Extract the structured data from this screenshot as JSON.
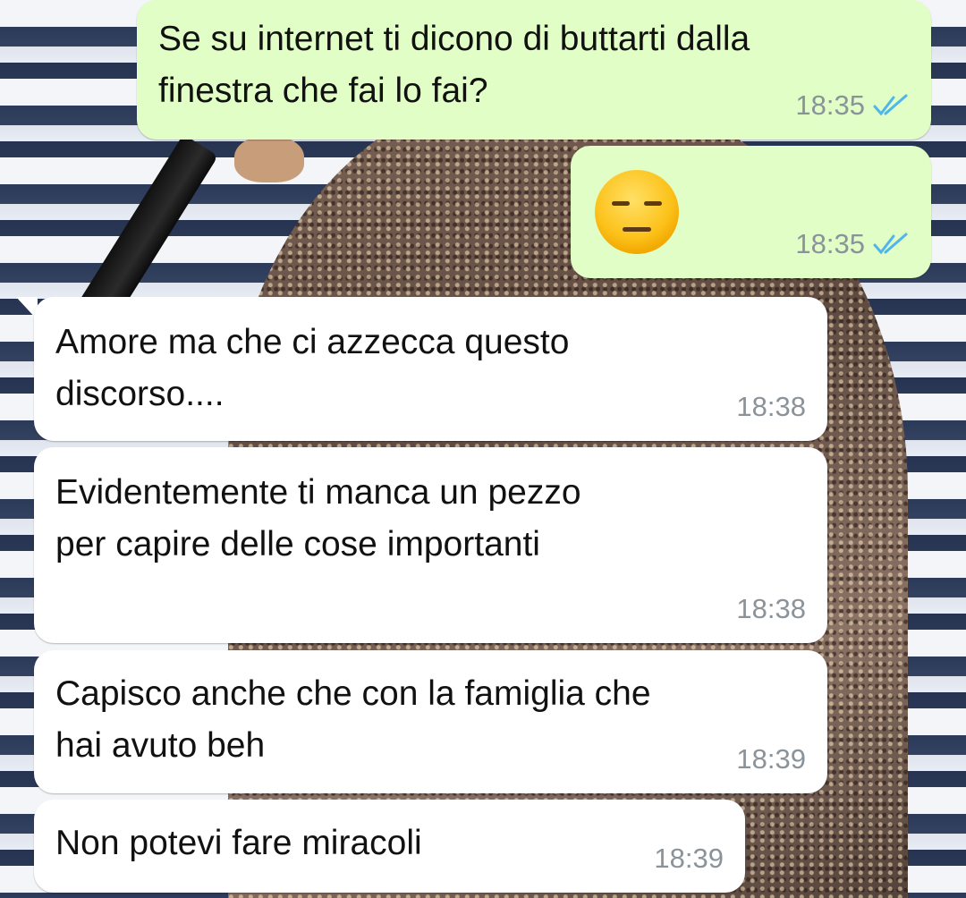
{
  "chat": {
    "messages": [
      {
        "direction": "outgoing",
        "text": "Se su internet ti dicono di buttarti dalla\nfinestra che fai lo fai?",
        "time": "18:35",
        "status": "read"
      },
      {
        "direction": "outgoing",
        "emoji": "expressionless-face",
        "time": "18:35",
        "status": "read"
      },
      {
        "direction": "incoming",
        "text": "Amore ma che ci azzecca questo\ndiscorso....",
        "time": "18:38"
      },
      {
        "direction": "incoming",
        "text": "Evidentemente ti manca un pezzo\nper capire delle cose importanti",
        "time": "18:38"
      },
      {
        "direction": "incoming",
        "text": "Capisco anche che con la famiglia che\nhai avuto beh",
        "time": "18:39"
      },
      {
        "direction": "incoming",
        "text": "Non potevi fare miracoli",
        "time": "18:39"
      }
    ]
  },
  "colors": {
    "outgoing_bubble": "#e1fec6",
    "incoming_bubble": "#ffffff",
    "timestamp": "#8b939a",
    "read_ticks": "#4fb6ec"
  }
}
